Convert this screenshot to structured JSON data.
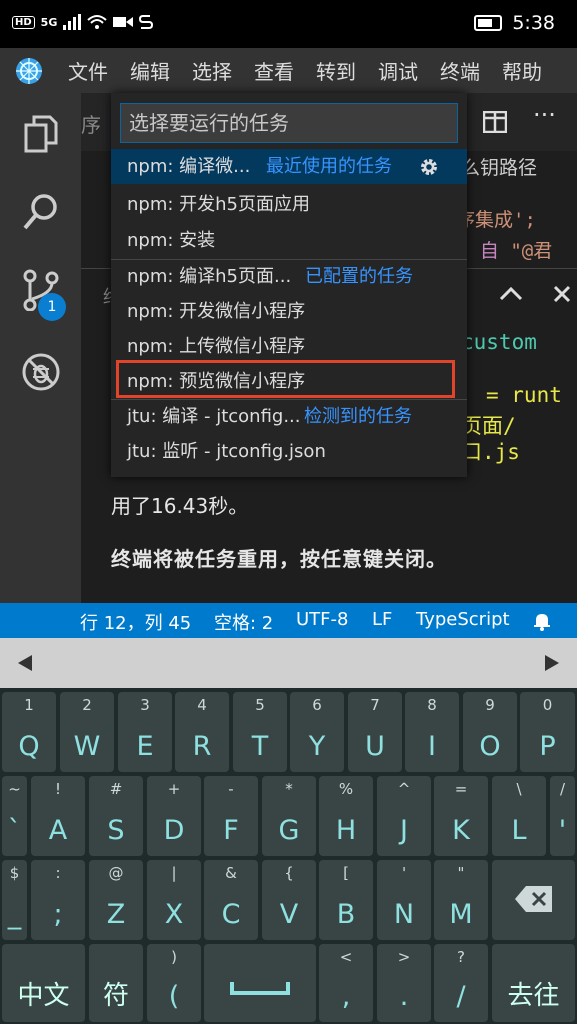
{
  "status_bar": {
    "time": "5:38",
    "hd": "HD",
    "net": "5G"
  },
  "menu": [
    "文件",
    "编辑",
    "选择",
    "查看",
    "转到",
    "调试",
    "终端",
    "帮助"
  ],
  "activity": {
    "scm_badge": "1"
  },
  "editor": {
    "tab_partial": "序",
    "line_path": "么钥路径",
    "line_integration": "序集成';",
    "line_from_a": "} 自 ",
    "line_from_b": "\"@君",
    "term_partial": "终",
    "custom": "custom",
    "runt": "= runt",
    "page": "页面/",
    "entry": "口.js"
  },
  "terminal": {
    "line1": "用了16.43秒。",
    "line2": "终端将被任务重用，按任意键关闭。"
  },
  "quick_pick": {
    "placeholder": "选择要运行的任务",
    "items": [
      {
        "label": "npm: 编译微...",
        "group": "最近使用的任务"
      },
      {
        "label": "npm: 开发h5页面应用",
        "group": ""
      },
      {
        "label": "npm: 安装",
        "group": ""
      },
      {
        "label": "npm: 编译h5页面...",
        "group": "已配置的任务"
      },
      {
        "label": "npm: 开发微信小程序",
        "group": ""
      },
      {
        "label": "npm: 上传微信小程序",
        "group": ""
      },
      {
        "label": "npm: 预览微信小程序",
        "group": ""
      },
      {
        "label": "jtu: 编译 - jtconfig...",
        "group": "检测到的任务"
      },
      {
        "label": "jtu: 监听 - jtconfig.json",
        "group": ""
      }
    ]
  },
  "vs_status": {
    "position": "行 12，列 45",
    "spaces": "空格: 2",
    "encoding": "UTF-8",
    "eol": "LF",
    "language": "TypeScript"
  },
  "keyboard": {
    "row1": [
      {
        "s": "1",
        "m": "Q"
      },
      {
        "s": "2",
        "m": "W"
      },
      {
        "s": "3",
        "m": "E"
      },
      {
        "s": "4",
        "m": "R"
      },
      {
        "s": "5",
        "m": "T"
      },
      {
        "s": "6",
        "m": "Y"
      },
      {
        "s": "7",
        "m": "U"
      },
      {
        "s": "8",
        "m": "I"
      },
      {
        "s": "9",
        "m": "O"
      },
      {
        "s": "0",
        "m": "P"
      }
    ],
    "row2": [
      {
        "s": "~",
        "m": "`"
      },
      {
        "s": "!",
        "m": "A"
      },
      {
        "s": "#",
        "m": "S"
      },
      {
        "s": "+",
        "m": "D"
      },
      {
        "s": "-",
        "m": "F"
      },
      {
        "s": "*",
        "m": "G"
      },
      {
        "s": "%",
        "m": "H"
      },
      {
        "s": "^",
        "m": "J"
      },
      {
        "s": "=",
        "m": "K"
      },
      {
        "s": "\\",
        "m": "L"
      },
      {
        "s": "/",
        "m": "'"
      }
    ],
    "row3": [
      {
        "s": "$",
        "m": "_"
      },
      {
        "s": ":",
        "m": ";"
      },
      {
        "s": "@",
        "m": "Z"
      },
      {
        "s": "|",
        "m": "X"
      },
      {
        "s": "&",
        "m": "C"
      },
      {
        "s": "{",
        "m": "V"
      },
      {
        "s": "[",
        "m": "B"
      },
      {
        "s": "'",
        "m": "N"
      },
      {
        "s": "\"",
        "m": "M"
      }
    ],
    "row4": [
      {
        "s": "",
        "m": "中文"
      },
      {
        "s": "",
        "m": "符"
      },
      {
        "s": ")",
        "m": "("
      },
      {
        "s": "",
        "m": ""
      },
      {
        "s": "<",
        "m": ","
      },
      {
        "s": ">",
        "m": "."
      },
      {
        "s": "?",
        "m": "/"
      },
      {
        "s": "",
        "m": "去往"
      }
    ]
  }
}
